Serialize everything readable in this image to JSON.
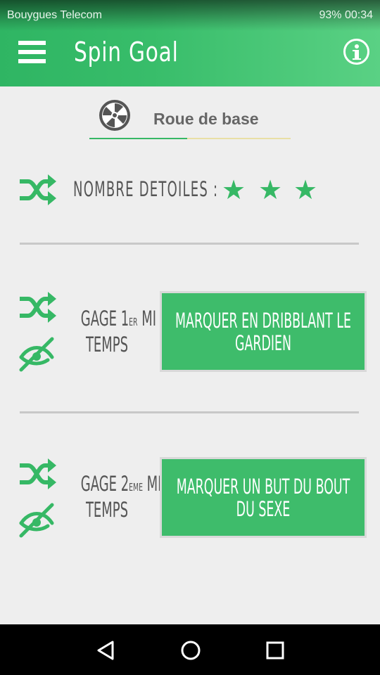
{
  "status_bar": {
    "carrier": "Bouygues Telecom",
    "battery": "93%",
    "time": "00:34"
  },
  "header": {
    "title": "Spin Goal",
    "menu_icon": "menu-icon",
    "info_icon": "info-icon"
  },
  "wheel_selector": {
    "label": "Roue de base",
    "icon": "wheel-icon"
  },
  "stars_row": {
    "label": "NOMBRE DETOILES :",
    "stars": [
      "★",
      "★",
      "★"
    ],
    "star_count": 3
  },
  "gage1": {
    "label_line1": "GAGE 1",
    "label_sup": "ER",
    "label_line1_end": " MI",
    "label_line2": "TEMPS",
    "button_text": "MARQUER EN DRIBBLANT LE GARDIEN"
  },
  "gage2": {
    "label_line1": "GAGE 2",
    "label_sup": "EME",
    "label_line1_end": " MI",
    "label_line2": "TEMPS",
    "button_text": "MARQUER UN BUT DU BOUT DU SEXE"
  },
  "colors": {
    "accent": "#36b865",
    "header_start": "#2fb563",
    "header_end": "#5ad184",
    "background": "#eeeeee"
  }
}
